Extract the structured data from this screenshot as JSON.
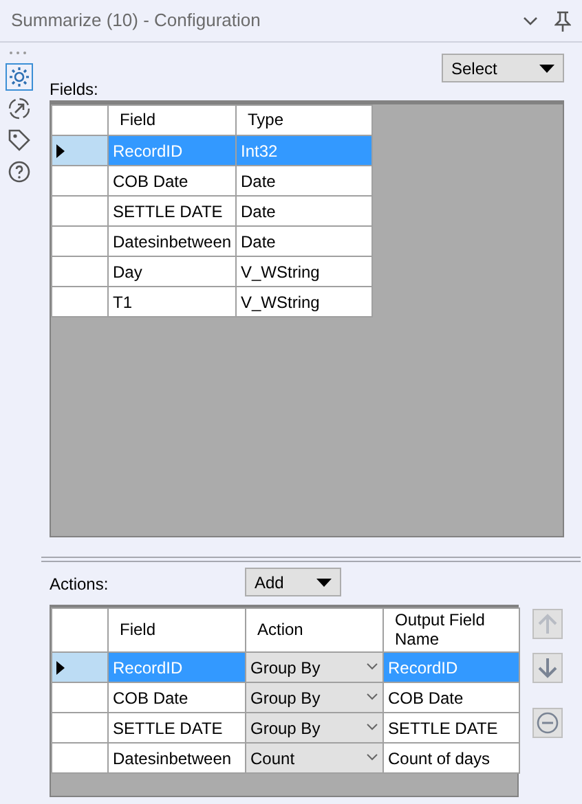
{
  "window": {
    "title": "Summarize (10) - Configuration"
  },
  "sidebar": {
    "items": [
      {
        "kind": "gear",
        "selected": true
      },
      {
        "kind": "arrow",
        "selected": false
      },
      {
        "kind": "tag",
        "selected": false
      },
      {
        "kind": "help",
        "selected": false
      }
    ]
  },
  "fields": {
    "dropdown": "Select",
    "label": "Fields:",
    "columns": [
      "Field",
      "Type"
    ],
    "rows": [
      {
        "field": "RecordID",
        "type": "Int32",
        "selected": true
      },
      {
        "field": "COB Date",
        "type": "Date",
        "selected": false
      },
      {
        "field": "SETTLE DATE",
        "type": "Date",
        "selected": false
      },
      {
        "field": "Datesinbetween",
        "type": "Date",
        "selected": false
      },
      {
        "field": "Day",
        "type": "V_WString",
        "selected": false
      },
      {
        "field": "T1",
        "type": "V_WString",
        "selected": false
      }
    ]
  },
  "actions": {
    "label": "Actions:",
    "dropdown": "Add",
    "columns": [
      "Field",
      "Action",
      "Output Field Name"
    ],
    "rows": [
      {
        "field": "RecordID",
        "action": "Group By",
        "output": "RecordID",
        "selected": true
      },
      {
        "field": "COB Date",
        "action": "Group By",
        "output": "COB Date",
        "selected": false
      },
      {
        "field": "SETTLE DATE",
        "action": "Group By",
        "output": "SETTLE DATE",
        "selected": false
      },
      {
        "field": "Datesinbetween",
        "action": "Count",
        "output": "Count of days",
        "selected": false
      }
    ],
    "side_buttons": [
      {
        "kind": "up",
        "disabled": true
      },
      {
        "kind": "down",
        "disabled": false
      },
      {
        "kind": "remove",
        "disabled": false
      }
    ]
  }
}
